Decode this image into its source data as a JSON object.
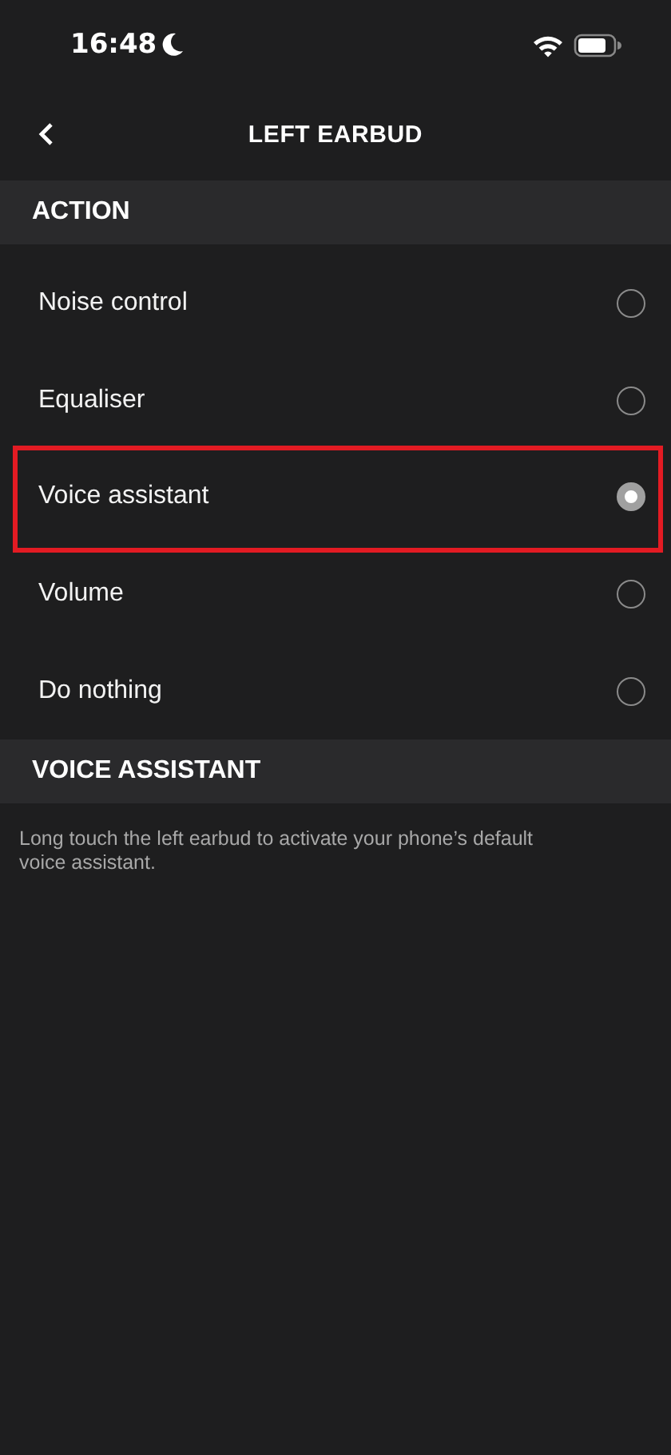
{
  "status_bar": {
    "time": "16:48"
  },
  "header": {
    "title": "LEFT EARBUD"
  },
  "sections": [
    {
      "title": "ACTION",
      "options": [
        {
          "label": "Noise control",
          "selected": false,
          "highlighted": false
        },
        {
          "label": "Equaliser",
          "selected": false,
          "highlighted": false
        },
        {
          "label": "Voice assistant",
          "selected": true,
          "highlighted": true
        },
        {
          "label": "Volume",
          "selected": false,
          "highlighted": false
        },
        {
          "label": "Do nothing",
          "selected": false,
          "highlighted": false
        }
      ]
    },
    {
      "title": "VOICE ASSISTANT",
      "description": "Long touch the left earbud to activate your phone’s default voice assistant."
    }
  ]
}
